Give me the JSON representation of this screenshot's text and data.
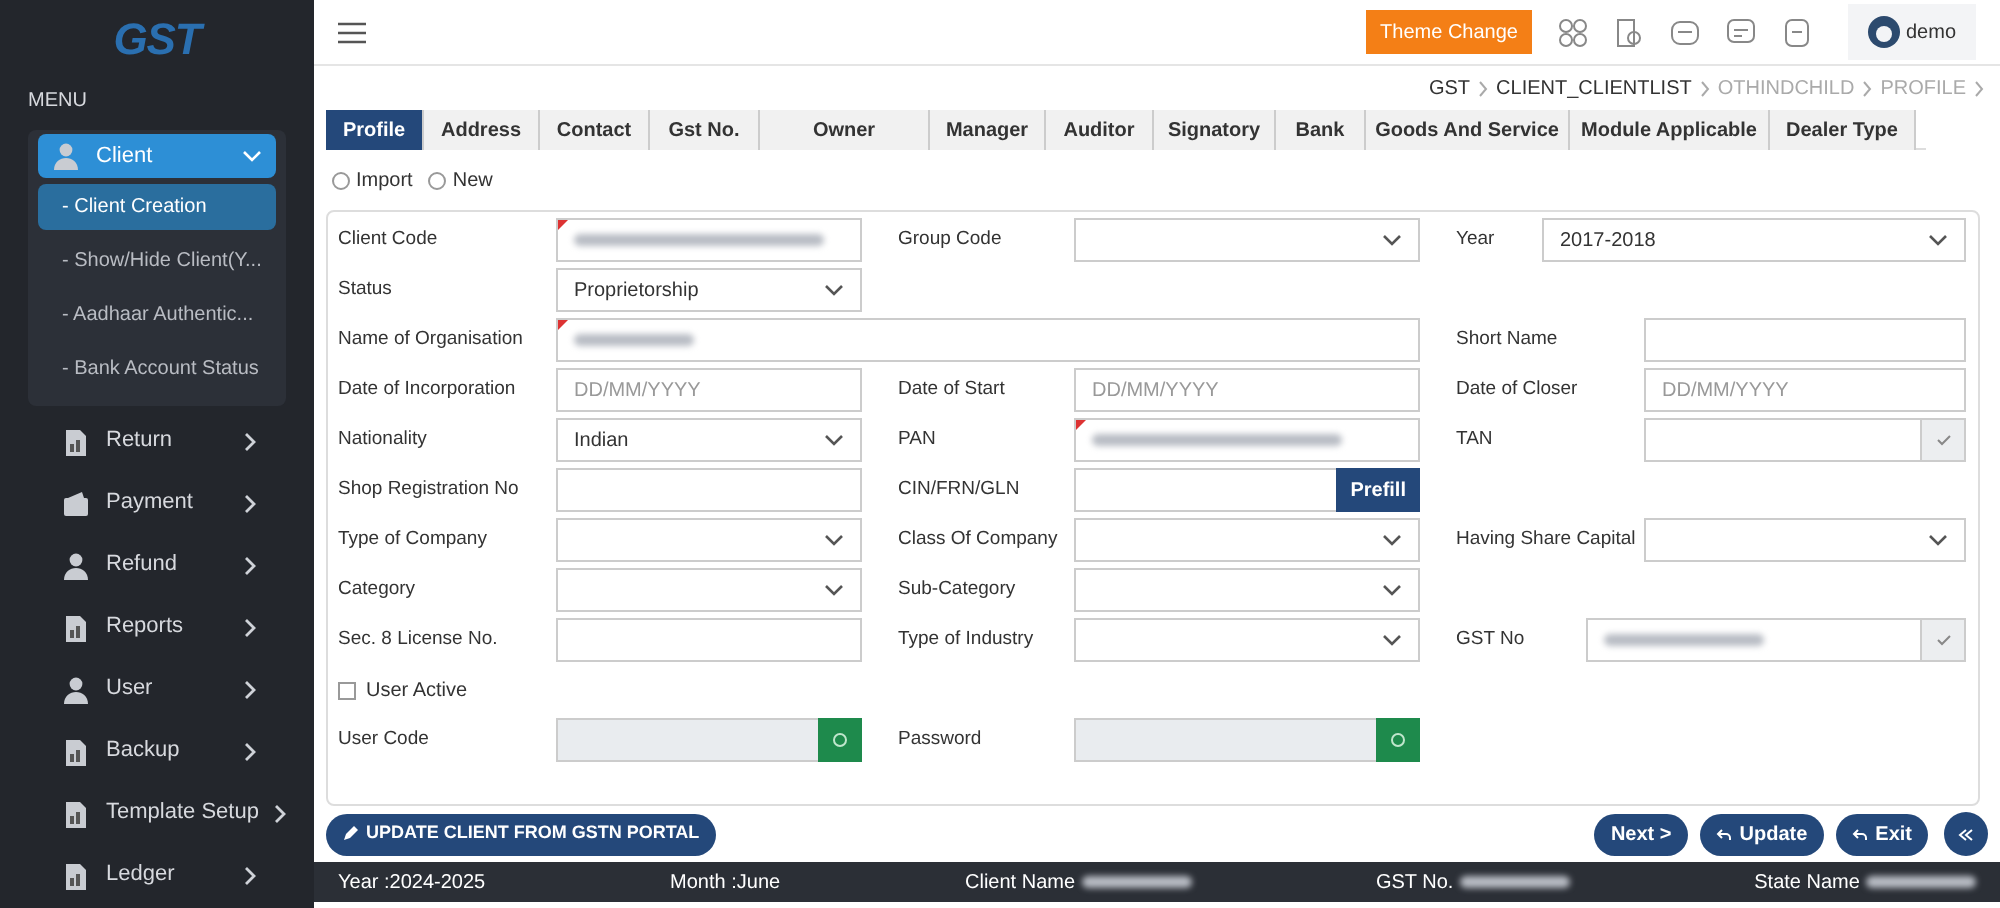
{
  "logo": {
    "text": "GST"
  },
  "menu_title": "MENU",
  "sidebar": {
    "items": [
      {
        "label": "Client",
        "expanded": true,
        "selected": true,
        "children": [
          {
            "label": "- Client Creation",
            "selected": true
          },
          {
            "label": "- Show/Hide Client(Y...",
            "selected": false
          },
          {
            "label": "- Aadhaar Authentic...",
            "selected": false
          },
          {
            "label": "- Bank Account Status",
            "selected": false
          }
        ]
      },
      {
        "label": "Return",
        "expanded": false,
        "selected": false
      },
      {
        "label": "Payment",
        "expanded": false,
        "selected": false
      },
      {
        "label": "Refund",
        "expanded": false,
        "selected": false
      },
      {
        "label": "Reports",
        "expanded": false,
        "selected": false
      },
      {
        "label": "User",
        "expanded": false,
        "selected": false
      },
      {
        "label": "Backup",
        "expanded": false,
        "selected": false
      },
      {
        "label": "Template Setup",
        "expanded": false,
        "selected": false
      },
      {
        "label": "Ledger",
        "expanded": false,
        "selected": false
      }
    ]
  },
  "topbar": {
    "theme_button": "Theme Change",
    "user": "demo"
  },
  "breadcrumb": [
    {
      "label": "GST",
      "active": true
    },
    {
      "label": "CLIENT_CLIENTLIST",
      "active": true
    },
    {
      "label": "OTHINDCHILD",
      "active": false
    },
    {
      "label": "PROFILE",
      "active": false
    }
  ],
  "tabs": [
    {
      "label": "Profile",
      "selected": true
    },
    {
      "label": "Address",
      "selected": false
    },
    {
      "label": "Contact",
      "selected": false
    },
    {
      "label": "Gst No.",
      "selected": false
    },
    {
      "label": "Owner",
      "selected": false
    },
    {
      "label": "Manager",
      "selected": false
    },
    {
      "label": "Auditor",
      "selected": false
    },
    {
      "label": "Signatory",
      "selected": false
    },
    {
      "label": "Bank",
      "selected": false
    },
    {
      "label": "Goods And Service",
      "selected": false
    },
    {
      "label": "Module Applicable",
      "selected": false
    },
    {
      "label": "Dealer Type",
      "selected": false
    }
  ],
  "mode_options": [
    {
      "label": "Import",
      "selected": false
    },
    {
      "label": "New",
      "selected": false
    }
  ],
  "form_rows": [
    {
      "left": {
        "label": "Client Code",
        "kind": "text",
        "required": true,
        "redacted": true
      },
      "middle": {
        "label": "Group Code",
        "kind": "select"
      },
      "right": {
        "label": "Year",
        "kind": "select",
        "value": "2017-2018"
      }
    },
    {
      "left": {
        "label": "Status",
        "kind": "select",
        "value": "Proprietorship"
      }
    },
    {
      "left": {
        "label": "Name of Organisation",
        "kind": "wide",
        "required": true,
        "redacted": true
      },
      "right": {
        "label": "Short Name",
        "kind": "text"
      }
    },
    {
      "left": {
        "label": "Date of Incorporation",
        "kind": "text",
        "placeholder": "DD/MM/YYYY"
      },
      "middle": {
        "label": "Date of Start",
        "kind": "text",
        "placeholder": "DD/MM/YYYY"
      },
      "right": {
        "label": "Date of Closer",
        "kind": "text",
        "placeholder": "DD/MM/YYYY"
      }
    },
    {
      "left": {
        "label": "Nationality",
        "kind": "select",
        "value": "Indian"
      },
      "middle": {
        "label": "PAN",
        "kind": "text",
        "required": true,
        "redacted": true
      },
      "right": {
        "label": "TAN",
        "kind": "check"
      }
    },
    {
      "left": {
        "label": "Shop Registration No",
        "kind": "text"
      },
      "middle": {
        "label": "CIN/FRN/GLN",
        "kind": "button",
        "button": "Prefill"
      }
    },
    {
      "left": {
        "label": "Type of Company",
        "kind": "select"
      },
      "middle": {
        "label": "Class Of Company",
        "kind": "select"
      },
      "right": {
        "label": "Having Share Capital",
        "kind": "select"
      }
    },
    {
      "left": {
        "label": "Category",
        "kind": "select"
      },
      "middle": {
        "label": "Sub-Category",
        "kind": "select"
      }
    },
    {
      "left": {
        "label": "Sec. 8 License No.",
        "kind": "text"
      },
      "middle": {
        "label": "Type of Industry",
        "kind": "select"
      },
      "right": {
        "label": "GST No",
        "kind": "check",
        "redacted": true
      }
    },
    {
      "left": {
        "label": "User Active",
        "kind": "checkbox",
        "checked": false
      }
    },
    {
      "left": {
        "label": "User Code",
        "kind": "green"
      },
      "middle": {
        "label": "Password",
        "kind": "green"
      }
    }
  ],
  "actions": {
    "gstn_button": "UPDATE CLIENT FROM GSTN PORTAL",
    "buttons": [
      {
        "label": "Next >",
        "kind": "plain"
      },
      {
        "label": "Update",
        "kind": "undo"
      },
      {
        "label": "Exit",
        "kind": "undo"
      }
    ]
  },
  "status_bar": [
    {
      "label": "Year :2024-2025"
    },
    {
      "label": "Month :June"
    },
    {
      "label": "Client Name",
      "redacted": true
    },
    {
      "label": "GST No.",
      "redacted": true
    },
    {
      "label": "State Name",
      "redacted": true
    }
  ]
}
